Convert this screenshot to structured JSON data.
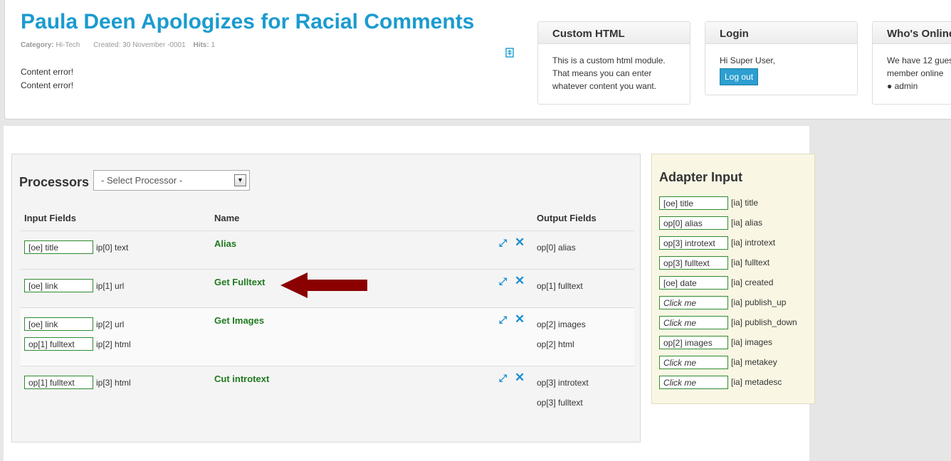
{
  "article": {
    "title": "Paula Deen Apologizes for Racial Comments",
    "meta": {
      "category_label": "Category:",
      "category_value": "Hi-Tech",
      "created": "Created: 30 November -0001",
      "hits_label": "Hits:",
      "hits_value": "1"
    },
    "content_lines": [
      "Content error!",
      "Content error!"
    ],
    "edit_icon": "edit-icon"
  },
  "modules": {
    "custom_html": {
      "title": "Custom HTML",
      "lines": [
        "This is a custom html module.",
        "That means you can enter",
        "whatever content you want."
      ]
    },
    "login": {
      "title": "Login",
      "greeting": "Hi Super User,",
      "logout_label": "Log out"
    },
    "whos_online": {
      "title": "Who's Online",
      "lines": [
        "We have 12 gues",
        "member online",
        "● admin"
      ]
    }
  },
  "processors": {
    "title": "Processors",
    "select_placeholder": "- Select Processor -",
    "columns": {
      "input": "Input Fields",
      "name": "Name",
      "output": "Output Fields"
    },
    "rows": [
      {
        "name": "Alias",
        "inputs": [
          {
            "box": "[oe] title",
            "label": "ip[0] text"
          }
        ],
        "outputs": [
          "op[0] alias"
        ]
      },
      {
        "name": "Get Fulltext",
        "inputs": [
          {
            "box": "[oe] link",
            "label": "ip[1] url"
          }
        ],
        "outputs": [
          "op[1] fulltext"
        ]
      },
      {
        "name": "Get Images",
        "inputs": [
          {
            "box": "[oe] link",
            "label": "ip[2] url"
          },
          {
            "box": "op[1] fulltext",
            "label": "ip[2] html"
          }
        ],
        "outputs": [
          "op[2] images",
          "op[2] html"
        ]
      },
      {
        "name": "Cut introtext",
        "inputs": [
          {
            "box": "op[1] fulltext",
            "label": "ip[3] html"
          }
        ],
        "outputs": [
          "op[3] introtext",
          "op[3] fulltext"
        ]
      }
    ]
  },
  "adapter": {
    "title": "Adapter Input",
    "rows": [
      {
        "box": "[oe] title",
        "label": "[ia] title",
        "italic": false
      },
      {
        "box": "op[0] alias",
        "label": "[ia] alias",
        "italic": false
      },
      {
        "box": "op[3] introtext",
        "label": "[ia] introtext",
        "italic": false
      },
      {
        "box": "op[3] fulltext",
        "label": "[ia] fulltext",
        "italic": false
      },
      {
        "box": "[oe] date",
        "label": "[ia] created",
        "italic": false
      },
      {
        "box": "Click me",
        "label": "[ia] publish_up",
        "italic": true
      },
      {
        "box": "Click me",
        "label": "[ia] publish_down",
        "italic": true
      },
      {
        "box": "op[2] images",
        "label": "[ia] images",
        "italic": false
      },
      {
        "box": "Click me",
        "label": "[ia] metakey",
        "italic": true
      },
      {
        "box": "Click me",
        "label": "[ia] metadesc",
        "italic": true
      }
    ]
  },
  "colors": {
    "title_blue": "#1b9bcf",
    "processor_green": "#1f7a1f",
    "field_border": "#2f8a2f",
    "arrow_red": "#8b0000"
  }
}
